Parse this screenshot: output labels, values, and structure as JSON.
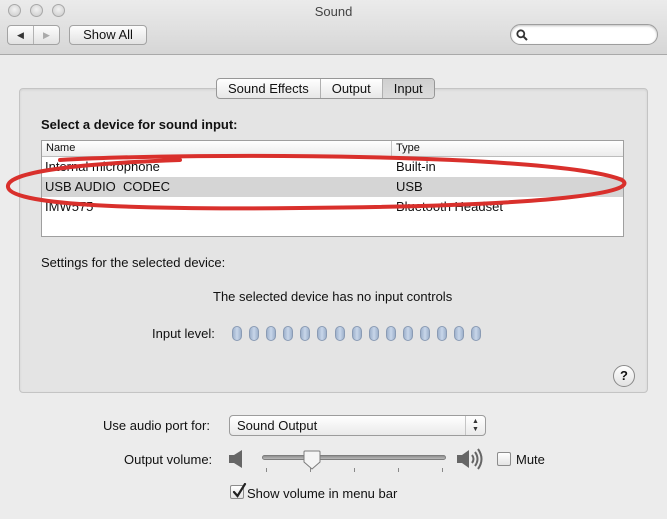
{
  "window": {
    "title": "Sound",
    "traffic_lights": [
      "close",
      "minimize",
      "zoom"
    ]
  },
  "toolbar": {
    "back_icon": "◀",
    "forward_icon": "▶",
    "show_all_label": "Show All",
    "search": {
      "value": "",
      "placeholder": ""
    }
  },
  "tabs": [
    {
      "label": "Sound Effects",
      "active": false
    },
    {
      "label": "Output",
      "active": false
    },
    {
      "label": "Input",
      "active": true
    }
  ],
  "input_pane": {
    "select_label": "Select a device for sound input:",
    "columns": [
      "Name",
      "Type"
    ],
    "devices": [
      {
        "name": "Internal microphone",
        "type": "Built-in",
        "selected": false
      },
      {
        "name": "USB AUDIO  CODEC",
        "type": "USB",
        "selected": true
      },
      {
        "name": "IMW575",
        "type": "Bluetooth Headset",
        "selected": false
      }
    ],
    "annotation": {
      "shape": "ellipse",
      "color": "#d9302c",
      "highlights": "USB AUDIO  CODEC"
    },
    "settings_label": "Settings for the selected device:",
    "no_controls_message": "The selected device has no input controls",
    "input_level_label": "Input level:",
    "input_level": {
      "segments": 15,
      "lit": 0
    },
    "help_label": "?"
  },
  "bottom": {
    "port_label": "Use audio port for:",
    "port_value": "Sound Output",
    "volume_label": "Output volume:",
    "volume_value": 0.26,
    "volume_ticks": 5,
    "mute_label": "Mute",
    "mute_checked": false,
    "show_in_menubar_label": "Show volume in menu bar",
    "show_in_menubar_checked": true
  }
}
